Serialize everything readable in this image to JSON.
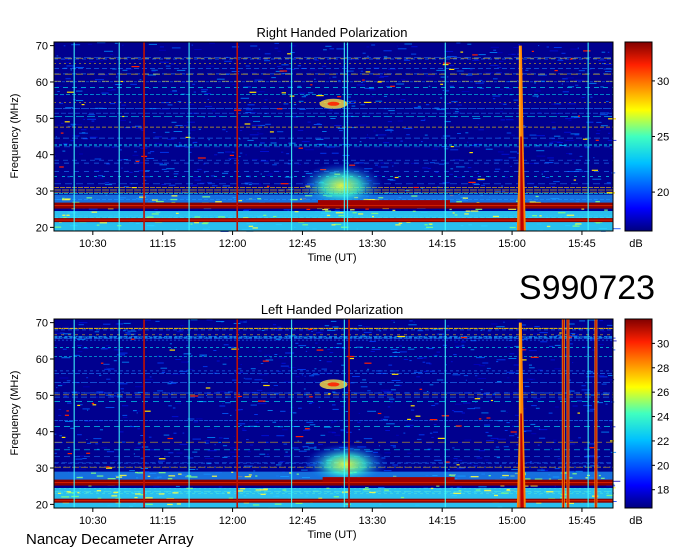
{
  "event_id": "S990723",
  "footer": "Nancay Decameter Array",
  "colors": {
    "background": "#00008f",
    "colormap": [
      "#00007f",
      "#0000ff",
      "#0080ff",
      "#00ffff",
      "#80ff80",
      "#ffff00",
      "#ff8000",
      "#ff0000",
      "#800000"
    ]
  },
  "chart_data": [
    {
      "type": "heatmap",
      "title": "Right Handed Polarization",
      "xlabel": "Time (UT)",
      "ylabel": "Frequency (MHz)",
      "xticks": [
        "10:30",
        "11:15",
        "12:00",
        "12:45",
        "13:30",
        "14:15",
        "15:00",
        "15:45"
      ],
      "xtick_minutes": [
        630,
        675,
        720,
        765,
        810,
        855,
        900,
        945
      ],
      "xlim_minutes": [
        605,
        965
      ],
      "yticks": [
        20,
        30,
        40,
        50,
        60,
        70
      ],
      "ylim": [
        19,
        71
      ],
      "colorbar": {
        "label": "dB",
        "ticks": [
          20,
          25,
          30
        ],
        "range": [
          16.5,
          33.5
        ]
      },
      "features": {
        "band_mhz": [
          26,
          22
        ],
        "red_vertical_minutes": [
          663,
          723
        ],
        "burst_minutes": 905,
        "burst_freq_top": 70,
        "cyan_vertical_minutes": [
          618,
          647,
          692,
          758,
          792,
          794,
          857,
          949
        ],
        "cloud": {
          "time": 790,
          "freq_lo": 27,
          "freq_hi": 36
        },
        "patch": {
          "time": 785,
          "freq": 54
        }
      }
    },
    {
      "type": "heatmap",
      "title": "Left Handed Polarization",
      "xlabel": "Time (UT)",
      "ylabel": "Frequency (MHz)",
      "xticks": [
        "10:30",
        "11:15",
        "12:00",
        "12:45",
        "13:30",
        "14:15",
        "15:00",
        "15:45"
      ],
      "xtick_minutes": [
        630,
        675,
        720,
        765,
        810,
        855,
        900,
        945
      ],
      "xlim_minutes": [
        605,
        965
      ],
      "yticks": [
        20,
        30,
        40,
        50,
        60,
        70
      ],
      "ylim": [
        19,
        71
      ],
      "colorbar": {
        "label": "dB",
        "ticks": [
          18,
          20,
          22,
          24,
          26,
          28,
          30
        ],
        "range": [
          16.5,
          32
        ]
      },
      "features": {
        "band_mhz": [
          26,
          21
        ],
        "red_vertical_minutes": [
          663,
          723,
          795
        ],
        "burst_minutes": 905,
        "burst_freq_top": 70,
        "secondary_burst_minutes": [
          933,
          936,
          954
        ],
        "cyan_vertical_minutes": [
          618,
          647,
          692,
          758,
          792,
          857,
          949
        ],
        "cloud": {
          "time": 793,
          "freq_lo": 27,
          "freq_hi": 35
        },
        "patch": {
          "time": 785,
          "freq": 53
        }
      }
    }
  ]
}
